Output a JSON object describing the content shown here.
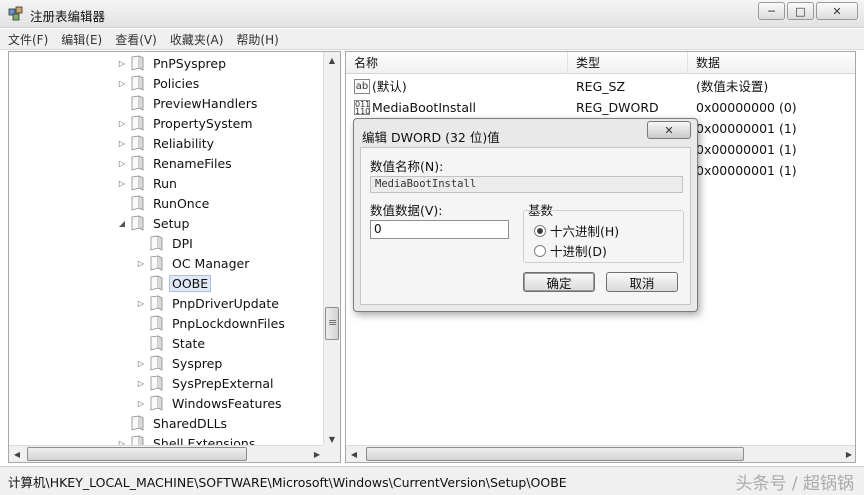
{
  "window": {
    "title": "注册表编辑器",
    "controls": {
      "minimize": "─",
      "maximize": "□",
      "close": "✕"
    }
  },
  "menu": [
    "文件(F)",
    "编辑(E)",
    "查看(V)",
    "收藏夹(A)",
    "帮助(H)"
  ],
  "tree": {
    "items": [
      {
        "label": "PnPSysprep",
        "level": 1,
        "expander": "▷"
      },
      {
        "label": "Policies",
        "level": 1,
        "expander": "▷"
      },
      {
        "label": "PreviewHandlers",
        "level": 1,
        "expander": ""
      },
      {
        "label": "PropertySystem",
        "level": 1,
        "expander": "▷"
      },
      {
        "label": "Reliability",
        "level": 1,
        "expander": "▷"
      },
      {
        "label": "RenameFiles",
        "level": 1,
        "expander": "▷"
      },
      {
        "label": "Run",
        "level": 1,
        "expander": "▷"
      },
      {
        "label": "RunOnce",
        "level": 1,
        "expander": ""
      },
      {
        "label": "Setup",
        "level": 1,
        "expander": "◢"
      },
      {
        "label": "DPI",
        "level": 2,
        "expander": ""
      },
      {
        "label": "OC Manager",
        "level": 2,
        "expander": "▷"
      },
      {
        "label": "OOBE",
        "level": 2,
        "expander": "",
        "selected": true
      },
      {
        "label": "PnpDriverUpdate",
        "level": 2,
        "expander": "▷"
      },
      {
        "label": "PnpLockdownFiles",
        "level": 2,
        "expander": ""
      },
      {
        "label": "State",
        "level": 2,
        "expander": ""
      },
      {
        "label": "Sysprep",
        "level": 2,
        "expander": "▷"
      },
      {
        "label": "SysPrepExternal",
        "level": 2,
        "expander": "▷"
      },
      {
        "label": "WindowsFeatures",
        "level": 2,
        "expander": "▷"
      },
      {
        "label": "SharedDLLs",
        "level": 1,
        "expander": ""
      },
      {
        "label": "Shell Extensions",
        "level": 1,
        "expander": "▷"
      }
    ]
  },
  "list": {
    "columns": [
      "名称",
      "类型",
      "数据"
    ],
    "rows": [
      {
        "icon": "ab",
        "name": "(默认)",
        "type": "REG_SZ",
        "data": "(数值未设置)"
      },
      {
        "icon": "011\n110",
        "name": "MediaBootInstall",
        "type": "REG_DWORD",
        "data": "0x00000000 (0)"
      },
      {
        "icon": "",
        "name": "",
        "type": "",
        "data": "0x00000001 (1)"
      },
      {
        "icon": "",
        "name": "",
        "type": "",
        "data": "0x00000001 (1)"
      },
      {
        "icon": "",
        "name": "",
        "type": "",
        "data": "0x00000001 (1)"
      }
    ]
  },
  "dialog": {
    "title": "编辑 DWORD (32 位)值",
    "close": "✕",
    "name_label": "数值名称(N):",
    "name_value": "MediaBootInstall",
    "data_label": "数值数据(V):",
    "data_value": "0",
    "base_label": "基数",
    "radio_hex": "十六进制(H)",
    "radio_dec": "十进制(D)",
    "hex_selected": true,
    "ok": "确定",
    "cancel": "取消"
  },
  "status": {
    "path": "计算机\\HKEY_LOCAL_MACHINE\\SOFTWARE\\Microsoft\\Windows\\CurrentVersion\\Setup\\OOBE",
    "watermark": "头条号 / 超锅锅"
  }
}
